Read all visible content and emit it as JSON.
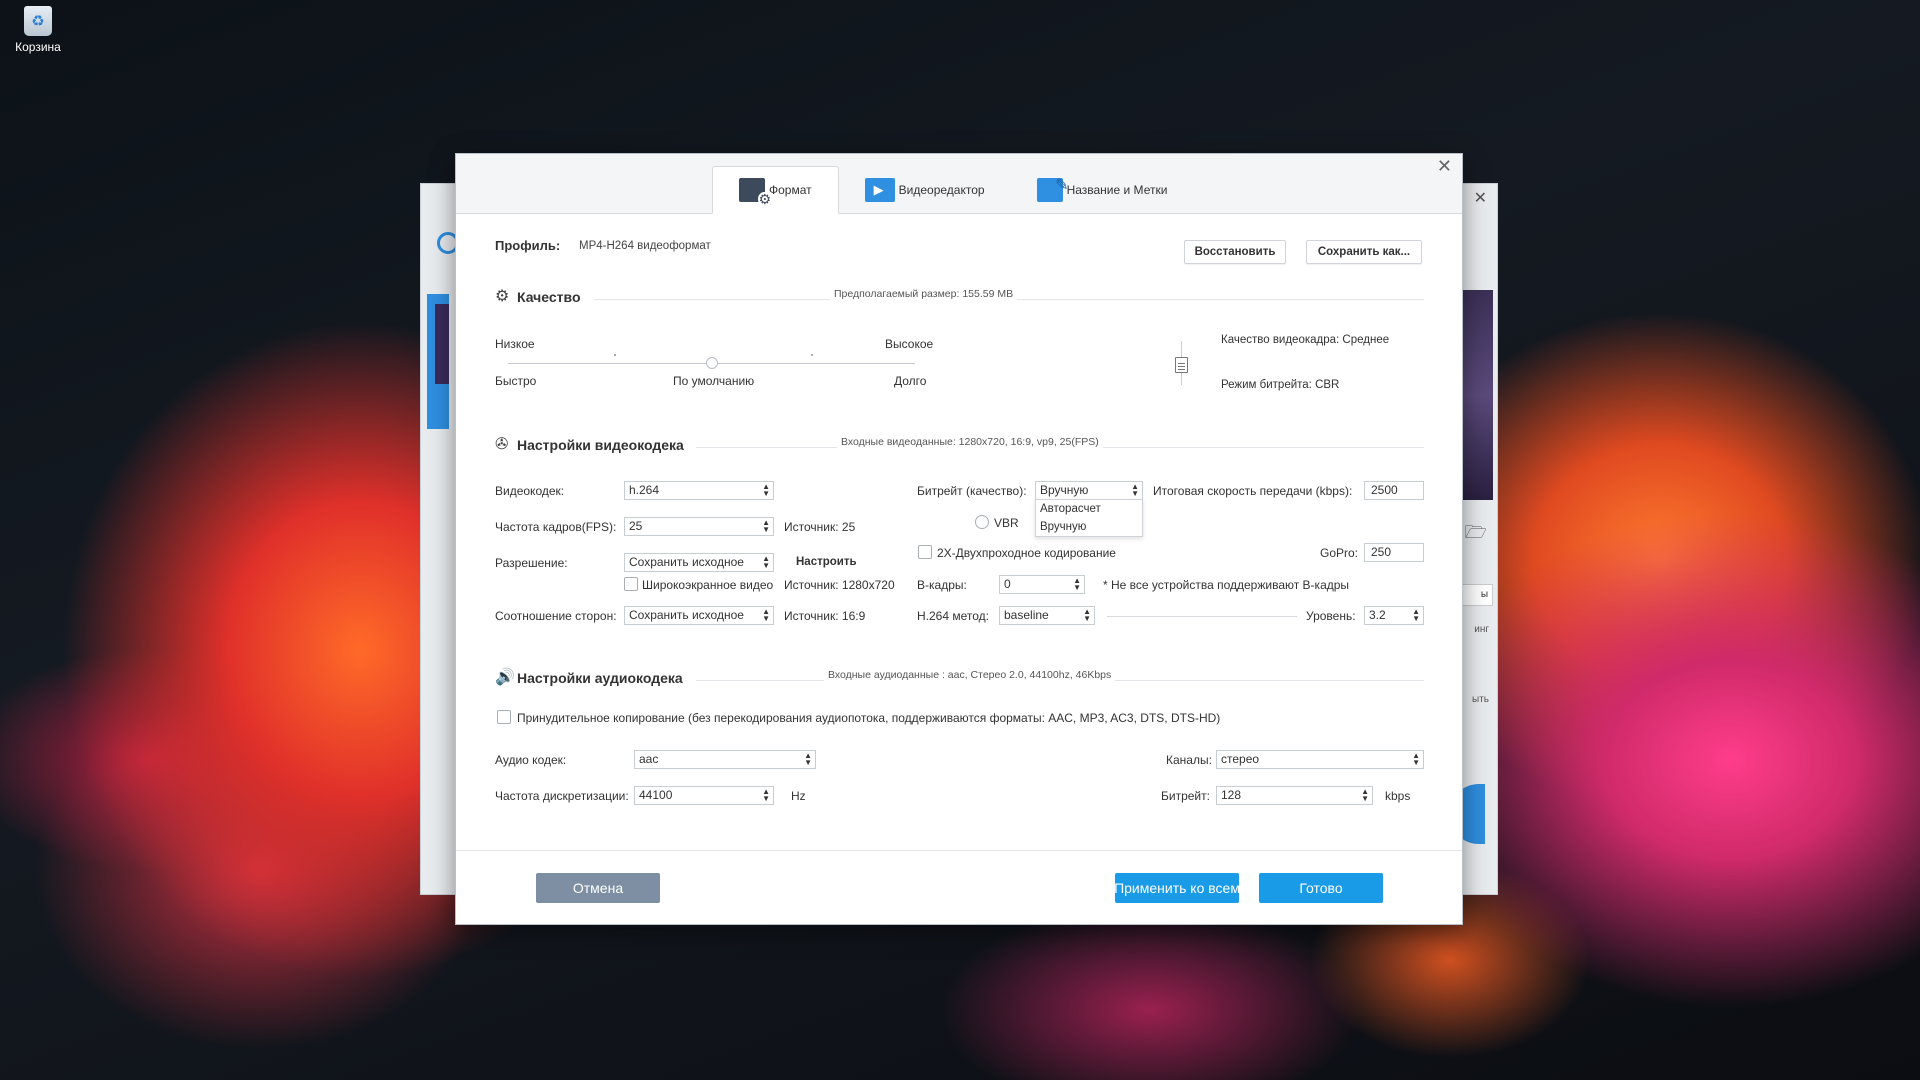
{
  "desktop": {
    "recycle_bin_label": "Корзина"
  },
  "bg_window": {
    "right_btn1": "ы",
    "right_btn2": "инг",
    "right_btn3": "ыть"
  },
  "tabs": [
    {
      "label": "Формат",
      "icon": "format-settings-icon"
    },
    {
      "label": "Видеоредактор",
      "icon": "video-editor-icon"
    },
    {
      "label": "Название и Метки",
      "icon": "title-tags-icon"
    }
  ],
  "profile": {
    "label": "Профиль:",
    "value": "MP4-H264 видеоформат",
    "restore_button": "Восстановить",
    "save_as_button": "Сохранить как..."
  },
  "quality": {
    "title": "Качество",
    "estimated_size": "Предполагаемый размер: 155.59 MB",
    "low": "Низкое",
    "high": "Высокое",
    "fast": "Быстро",
    "default": "По умолчанию",
    "slow": "Долго",
    "slider_position": 0.5,
    "frame_quality": "Качество видеокадра: Среднее",
    "bitrate_mode": "Режим битрейта: CBR"
  },
  "video": {
    "title": "Настройки видеокодека",
    "input_info": "Входные видеоданные: 1280x720, 16:9, vp9, 25(FPS)",
    "codec_label": "Видеокодек:",
    "codec_value": "h.264",
    "fps_label": "Частота кадров(FPS):",
    "fps_value": "25",
    "fps_source": "Источник: 25",
    "resolution_label": "Разрешение:",
    "resolution_value": "Сохранить исходное",
    "configure_button": "Настроить",
    "widescreen_label": "Широкоэкранное видео",
    "resolution_source": "Источник: 1280x720",
    "aspect_label": "Соотношение сторон:",
    "aspect_value": "Сохранить исходное",
    "aspect_source": "Источник: 16:9",
    "bitrate_label": "Битрейт (качество):",
    "bitrate_value": "Вручную",
    "bitrate_options": [
      "Авторасчет",
      "Вручную"
    ],
    "vbr_label": "VBR",
    "total_speed_label": "Итоговая скорость передачи (kbps):",
    "total_speed_value": "2500",
    "two_pass_label": "2X-Двухпроходное кодирование",
    "gopro_label": "GoPro:",
    "gopro_value": "250",
    "bframes_label": "B-кадры:",
    "bframes_value": "0",
    "bframes_note": "* Не все устройства поддерживают B-кадры",
    "h264_method_label": "H.264 метод:",
    "h264_method_value": "baseline",
    "level_label": "Уровень:",
    "level_value": "3.2"
  },
  "audio": {
    "title": "Настройки аудиокодека",
    "input_info": "Входные аудиоданные : aac, Стерео 2.0, 44100hz, 46Kbps",
    "force_copy_label": "Принудительное копирование (без перекодирования аудиопотока, поддерживаются форматы: AAC, MP3, AC3, DTS, DTS-HD)",
    "codec_label": "Аудио кодек:",
    "codec_value": "aac",
    "channels_label": "Каналы:",
    "channels_value": "стерео",
    "sample_rate_label": "Частота дискретизации:",
    "sample_rate_value": "44100",
    "sample_rate_unit": "Hz",
    "bitrate_label": "Битрейт:",
    "bitrate_value": "128",
    "bitrate_unit": "kbps"
  },
  "footer": {
    "cancel": "Отмена",
    "apply_all": "Применить ко всем",
    "done": "Готово"
  },
  "colors": {
    "accent": "#1a9be8",
    "cancel": "#7e8fa4"
  }
}
